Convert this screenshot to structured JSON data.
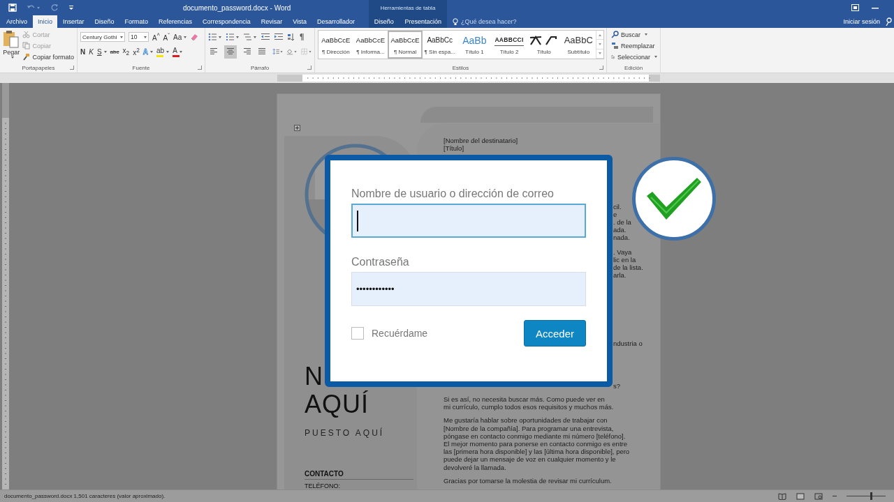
{
  "title_bar": {
    "title": "documento_password.docx - Word",
    "quick_access": [
      {
        "kind": "save",
        "disabled": false
      },
      {
        "kind": "undo",
        "disabled": true
      },
      {
        "kind": "redo",
        "disabled": true
      },
      {
        "kind": "customize",
        "disabled": false
      }
    ]
  },
  "tabs": [
    {
      "label": "Archivo",
      "selected": false
    },
    {
      "label": "Inicio",
      "selected": true
    },
    {
      "label": "Insertar",
      "selected": false
    },
    {
      "label": "Diseño",
      "selected": false
    },
    {
      "label": "Formato",
      "selected": false
    },
    {
      "label": "Referencias",
      "selected": false
    },
    {
      "label": "Correspondencia",
      "selected": false
    },
    {
      "label": "Revisar",
      "selected": false
    },
    {
      "label": "Vista",
      "selected": false
    },
    {
      "label": "Desarrollador",
      "selected": false
    }
  ],
  "contextual_tabs": {
    "label": "Herramientas de tabla",
    "tabs": [
      {
        "label": "Diseño",
        "selected": false
      },
      {
        "label": "Presentación",
        "selected": false
      }
    ]
  },
  "tell_me": "¿Qué desea hacer?",
  "sign_in": "Iniciar sesión",
  "ribbon": {
    "clipboard": {
      "title": "Portapapeles",
      "paste": "Pegar",
      "items": [
        {
          "kind": "cut",
          "label": "Cortar",
          "disabled": true
        },
        {
          "kind": "copy",
          "label": "Copiar",
          "disabled": true
        },
        {
          "kind": "format",
          "label": "Copiar formato",
          "disabled": false
        }
      ]
    },
    "font": {
      "title": "Fuente",
      "name": "Century Gothi",
      "size": "10",
      "top_tools": [
        {
          "kind": "plain",
          "label": "A$^{^}$"
        },
        {
          "kind": "plain",
          "label": "A$^{ˇ}$"
        },
        {
          "kind": "menu",
          "label": "Aa"
        }
      ],
      "bottom_tools": [
        {
          "kind": "bold",
          "label": "N"
        },
        {
          "kind": "italic",
          "label": "K"
        },
        {
          "kind": "underline",
          "label": "S"
        },
        {
          "kind": "strike",
          "label": "abc"
        },
        {
          "kind": "plain",
          "label": "x$_{2}$"
        },
        {
          "kind": "plain",
          "label": "x$^{2}$"
        },
        {
          "kind": "effects",
          "label": "A"
        },
        {
          "kind": "swatch",
          "label": "ab",
          "color": "#f2e600"
        },
        {
          "kind": "swatch",
          "label": "A",
          "color": "#d81e1e"
        }
      ]
    },
    "paragraph": {
      "title": "Párrafo",
      "alignments": [
        {
          "kind": "left",
          "selected": false
        },
        {
          "kind": "center",
          "selected": true
        },
        {
          "kind": "right",
          "selected": false
        },
        {
          "kind": "justify",
          "selected": false
        }
      ]
    },
    "styles": {
      "title": "Estilos",
      "items": [
        {
          "kind": "body",
          "preview": "AaBbCcE",
          "label": "¶ Dirección",
          "selected": false
        },
        {
          "kind": "body",
          "preview": "AaBbCcE",
          "label": "¶ Informa...",
          "selected": false
        },
        {
          "kind": "body",
          "preview": "AaBbCcE",
          "label": "¶ Normal",
          "selected": true
        },
        {
          "kind": "nospace",
          "preview": "AaBbCc",
          "label": "¶ Sin espa...",
          "selected": false
        },
        {
          "kind": "heading1",
          "preview": "AaBb",
          "label": "Título 1",
          "selected": false
        },
        {
          "kind": "heading2",
          "preview": "AABBCCI",
          "label": "Título 2",
          "selected": false
        },
        {
          "kind": "title",
          "label": "Título",
          "selected": false
        },
        {
          "kind": "subtitle",
          "preview": "AaBbC",
          "label": "Subtítulo",
          "selected": false
        }
      ]
    },
    "editing": {
      "title": "Edición",
      "items": [
        {
          "kind": "find",
          "label": "Buscar",
          "menu": true
        },
        {
          "kind": "replace",
          "label": "Reemplazar",
          "menu": false
        },
        {
          "kind": "select",
          "label": "Seleccionar",
          "menu": true
        }
      ]
    }
  },
  "document": {
    "recipient": [
      "[Nombre del destinatario]",
      "[Título]"
    ],
    "fragments_1": [
      "cil.",
      "e",
      ". de la",
      "ada.",
      "nada."
    ],
    "fragments_2": [
      ". Vaya",
      "lic en la",
      "de la lista.",
      "arla."
    ],
    "fragment_3": "ndustria o",
    "fragment_4": "s?",
    "paragraphs": [
      "Si es así, no necesita buscar más. Como puede ver en\nmi currículo, cumplo todos esos requisitos y muchos más.",
      "Me gustaría hablar sobre oportunidades de trabajar con\n[Nombre de la compañía]. Para programar una entrevista,\npóngase en contacto conmigo mediante mi número [teléfono].\nEl mejor momento para ponerse en contacto conmigo es entre\nlas [primera hora disponible] y las [última hora disponible], pero\npuede dejar un mensaje de voz en cualquier momento y le\ndevolveré la llamada.",
      "Gracias por tomarse la molestia de revisar mi currículum."
    ],
    "name_visible": "N",
    "name_line_2": "AQUÍ",
    "job_title": "PUESTO AQUÍ",
    "contact_heading": "CONTACTO",
    "phone_label": "TELÉFONO:"
  },
  "login_dialog": {
    "username_label": "Nombre de usuario o dirección de correo",
    "username_focused": true,
    "password_label": "Contraseña",
    "password_value": "••••••••••••",
    "remember_label": "Recuérdame",
    "remember_checked": false,
    "submit": "Acceder"
  },
  "status_bar": {
    "text": "documento_password.docx 1,501 caracteres (valor aproximado).",
    "zoom_slider": {
      "level": 0.62
    }
  }
}
